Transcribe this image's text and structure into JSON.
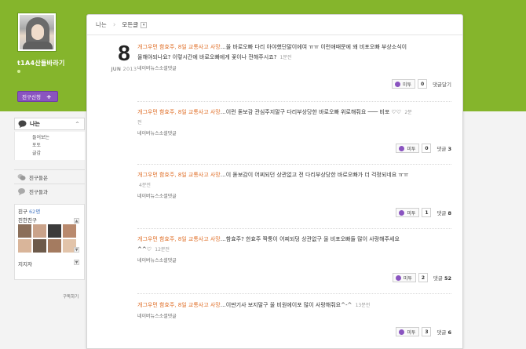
{
  "profile": {
    "username": "t1A4산들바라기",
    "friend_button": "친구신청",
    "friend_button_plus": "+"
  },
  "sidebar": {
    "me_label": "나는",
    "me_arrow": "^",
    "sub_items": [
      "들어보는",
      "포토",
      "글감"
    ],
    "friend_news": "친구들은",
    "friend_buzz": "친구들과",
    "friends_label": "친구",
    "friends_count": "62명",
    "close_friends": "친한친구",
    "supporters": "지지자",
    "subscribe": "구독하기",
    "thumb_colors": [
      "#8b6f5a",
      "#caa38a",
      "#3b3b3b",
      "#b98a6e",
      "#d9b59a",
      "#6d5a4a",
      "#a47b60",
      "#e2c4aa",
      "#5a4a3e",
      "#c79c7d",
      "#7e6654",
      "#d4b196"
    ]
  },
  "breadcrumb": {
    "root": "나는",
    "separator": "›",
    "current": "모든글",
    "dropdown": "▾"
  },
  "date": {
    "day": "8",
    "month": "JUN",
    "year": "2013"
  },
  "posts": [
    {
      "link": "개그우먼 함효주, 8일 교통사고 사망",
      "text": "…올 바로오빠 다리 아야했단말이에여 ㅠㅠ 이런애때문에 왜 비포오빠 부상소식이 올해야되나요? 이렇시간에 바로오빠에게 꽃이나 전해주시죠?",
      "ago": "1분전",
      "source": "네이버뉴스소셜댓글",
      "metoo": "미투",
      "likes": "0",
      "comment": "댓글달기",
      "comment_count": ""
    },
    {
      "link": "개그우먼 함효주, 8일 교통사고 사망",
      "text": "…이런 돋보감 관심주지말구 다리부상당한 바로오빠 위로해줘요 ─── 비포 ♡♡",
      "ago": "2분전",
      "source": "네이버뉴스소셜댓글",
      "metoo": "미투",
      "likes": "0",
      "comment": "댓글",
      "comment_count": "3"
    },
    {
      "link": "개그우먼 함효주, 8일 교통사고 사망",
      "text": "…이 돋보감이 어찌되던 상관없고 전 다리부상당한 바로오빠가 더 걱정되네요 ㅠㅠ",
      "ago": "4분전",
      "source": "네이버뉴스소셜댓글",
      "metoo": "미투",
      "likes": "1",
      "comment": "댓글",
      "comment_count": "8"
    },
    {
      "link": "개그우먼 함효주, 8일 교통사고 사망",
      "text": "…함효주? 한효주 짝퉁이 어찌되덩 상관없구 울 비포오빠들 많이 사랑해주세요^^♡",
      "ago": "12분전",
      "source": "네이버뉴스소셜댓글",
      "metoo": "미투",
      "likes": "2",
      "comment": "댓글",
      "comment_count": "52"
    },
    {
      "link": "개그우먼 함효주, 8일 교통사고 사망",
      "text": "…이딴기사 보지말구 울 비원에이포 많이 사랑해줘요^-^",
      "ago": "13분전",
      "source": "네이버뉴스소셜댓글",
      "metoo": "미투",
      "likes": "3",
      "comment": "댓글",
      "comment_count": "6"
    }
  ],
  "colors": {
    "header_green": "#85b52c",
    "accent_purple": "#8a54c0",
    "link_orange": "#e0702a"
  }
}
